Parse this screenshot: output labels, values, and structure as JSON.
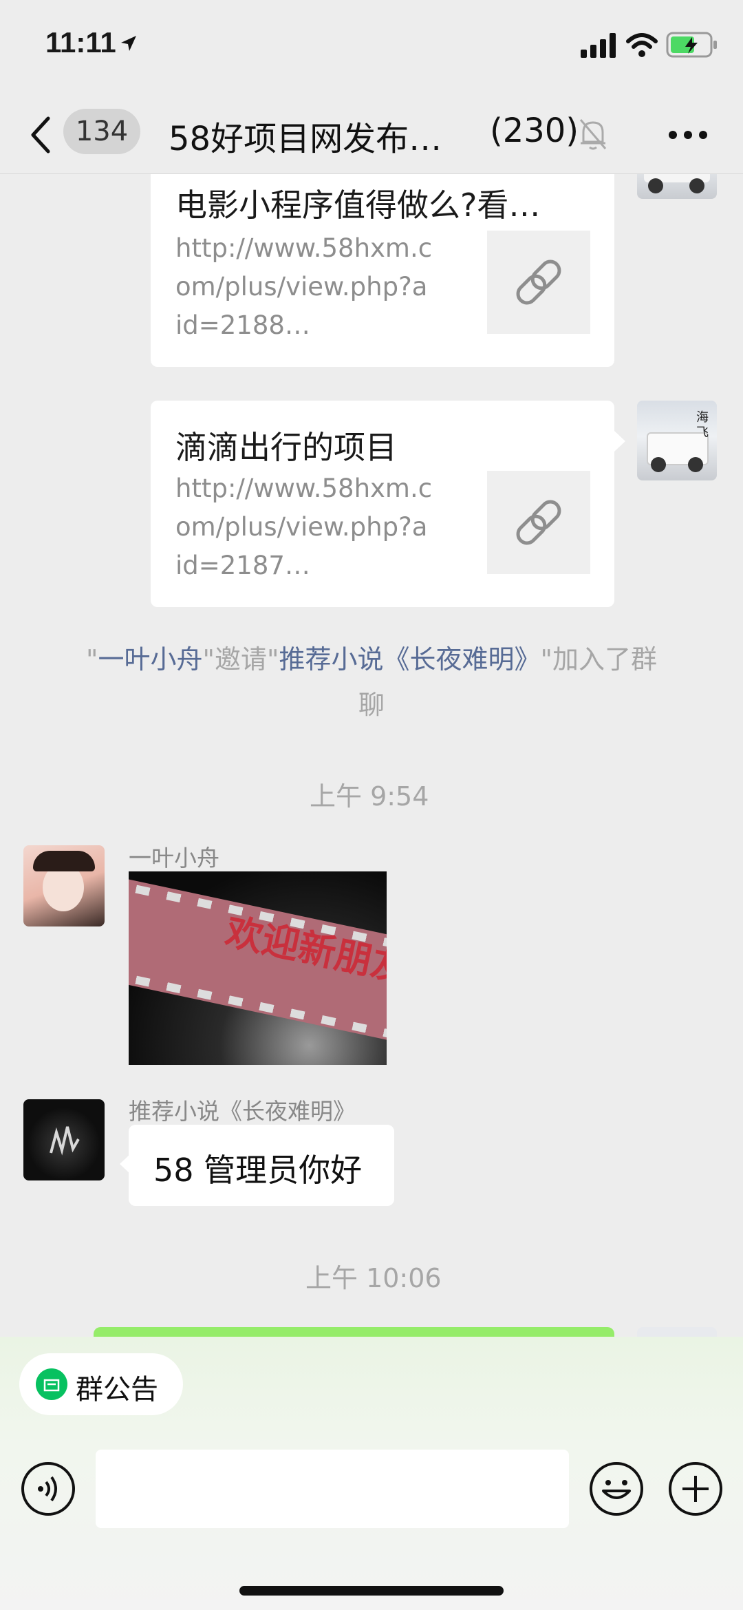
{
  "status_bar": {
    "time": "11:11"
  },
  "header": {
    "back_count": "134",
    "title": "58好项目网发布…",
    "member_count": "(230)"
  },
  "messages": {
    "card1": {
      "title": "电影小程序值得做么?看…",
      "url_lines": [
        "http://www.58hxm.c",
        "om/plus/view.php?a",
        "id=2188…"
      ]
    },
    "card2": {
      "title": "滴滴出行的项目",
      "url_lines": [
        "http://www.58hxm.c",
        "om/plus/view.php?a",
        "id=2187…"
      ],
      "avatar_text": "海飞"
    },
    "system": {
      "q1": "\"",
      "inviter": "一叶小舟",
      "q2": "\"",
      "invite_word": "邀请",
      "q3": "\"",
      "invitee": "推荐小说《长夜难明》",
      "q4": "\"",
      "joined_line1": "加入了群",
      "joined_line2": "聊"
    },
    "time1": "上午 9:54",
    "msg1": {
      "sender": "一叶小舟",
      "image_text": "欢迎新朋友"
    },
    "msg2": {
      "sender": "推荐小说《长夜难明》",
      "text": "58 管理员你好"
    },
    "time2": "上午 10:06"
  },
  "bottom": {
    "notice_label": "群公告"
  },
  "colors": {
    "accent_green": "#07c160",
    "link_blue": "#576b95",
    "gray_text": "#a6a6a6"
  },
  "icons": [
    "back-icon",
    "mute-bell-icon",
    "more-icon",
    "link-icon",
    "voice-icon",
    "emoji-icon",
    "plus-icon"
  ]
}
